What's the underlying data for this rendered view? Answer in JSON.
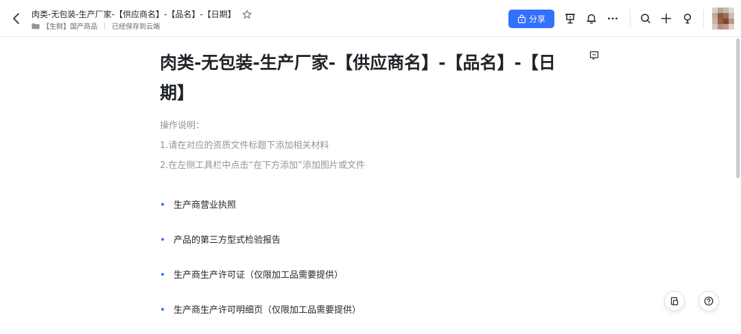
{
  "header": {
    "doc_title": "肉类-无包装-生产厂家-【供应商名】-【品名】-【日期】",
    "folder": "【生鲜】国产商品",
    "save_status": "已经保存到云端",
    "share_label": "分享"
  },
  "icons": {
    "back": "chevron-left-icon",
    "star": "star-icon",
    "folder": "folder-icon",
    "share": "share-icon",
    "present": "presentation-icon",
    "bell": "bell-icon",
    "more": "more-icon",
    "search": "search-icon",
    "add": "plus-icon",
    "tips": "lightbulb-icon",
    "comment": "comment-icon",
    "clipboard": "clipboard-icon",
    "help": "help-icon"
  },
  "doc": {
    "title": "肉类-无包装-生产厂家-【供应商名】-【品名】-【日期】",
    "notes": [
      "操作说明：",
      "1.请在对应的资质文件标题下添加相关材料",
      "2.在左侧工具栏中点击“在下方添加”添加图片或文件"
    ],
    "items": [
      "生产商营业执照",
      "产品的第三方型式检验报告",
      "生产商生产许可证（仅限加工品需要提供）",
      "生产商生产许可明细页（仅限加工品需要提供）"
    ]
  },
  "colors": {
    "accent": "#3370ff",
    "text": "#1f2329",
    "muted": "#8f959e"
  }
}
